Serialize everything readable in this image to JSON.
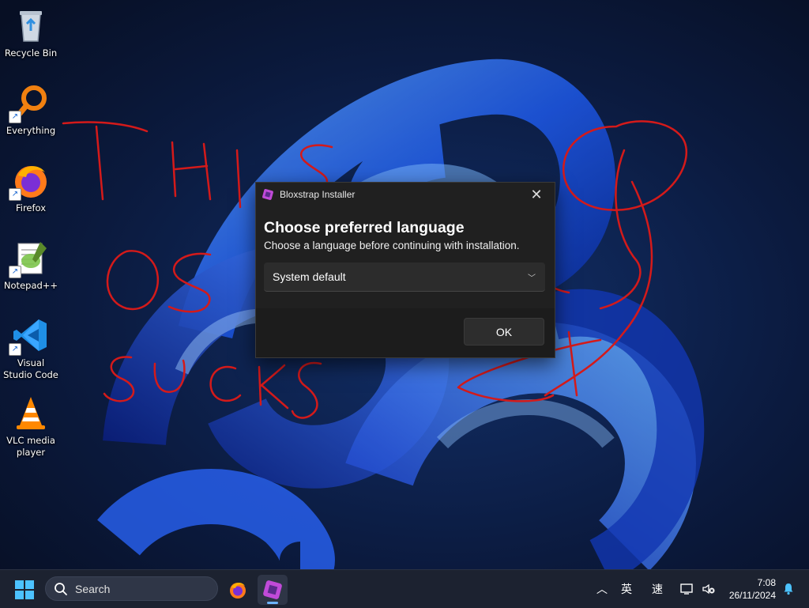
{
  "desktop": {
    "icons": [
      {
        "label": "Recycle Bin"
      },
      {
        "label": "Everything"
      },
      {
        "label": "Firefox"
      },
      {
        "label": "Notepad++"
      },
      {
        "label": "Visual Studio Code"
      },
      {
        "label": "VLC media player"
      }
    ],
    "scribble_text": [
      "THIS",
      "OS",
      "SUCKS"
    ]
  },
  "dialog": {
    "title": "Bloxstrap Installer",
    "heading": "Choose preferred language",
    "subheading": "Choose a language before continuing with installation.",
    "language_select": {
      "value": "System default"
    },
    "ok_label": "OK",
    "close_icon": "close-icon"
  },
  "taskbar": {
    "search_label": "Search",
    "ime_mode": "英",
    "ime_speed": "速",
    "time": "7:08",
    "date": "26/11/2024",
    "accent": "#6cb4ff"
  }
}
